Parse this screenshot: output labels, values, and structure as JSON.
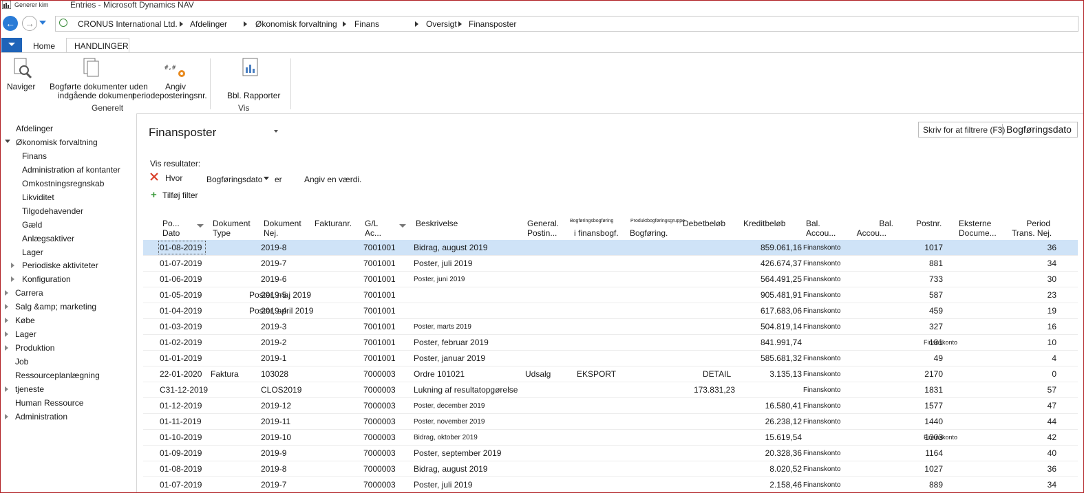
{
  "window": {
    "app_short": "Generer kim",
    "title": "Entries - Microsoft Dynamics NAV"
  },
  "breadcrumb": {
    "items": [
      "CRONUS International Ltd.",
      "Afdelinger",
      "Økonomisk forvaltning",
      "Finans",
      "Oversigt",
      "Finansposter"
    ]
  },
  "ribbon": {
    "tabs": [
      "Home",
      "HANDLINGER"
    ],
    "buttons": {
      "naviger": "Naviger",
      "bogforte_line1": "Bogførte dokumenter uden",
      "bogforte_line2": "indgående dokument",
      "angiv_line1": "Angiv",
      "angiv_line2": "periodeposteringsnr.",
      "rapporter": "Bbl. Rapporter"
    },
    "groups": {
      "generelt": "Generelt",
      "vis": "Vis"
    }
  },
  "sidebar": {
    "items": [
      {
        "label": "Afdelinger"
      },
      {
        "label": "Økonomisk forvaltning"
      },
      {
        "label": "Finans"
      },
      {
        "label": "Administration af kontanter"
      },
      {
        "label": "Omkostningsregnskab"
      },
      {
        "label": "Likviditet"
      },
      {
        "label": "Tilgodehavender"
      },
      {
        "label": "Gæld"
      },
      {
        "label": "Anlægsaktiver"
      },
      {
        "label": "Lager"
      },
      {
        "label": "Periodiske aktiviteter"
      },
      {
        "label": "Konfiguration"
      },
      {
        "label": "Carrera"
      },
      {
        "label": "Salg &amp; marketing"
      },
      {
        "label": "Købe"
      },
      {
        "label": "Lager"
      },
      {
        "label": "Produktion"
      },
      {
        "label": "Job"
      },
      {
        "label": "Ressourceplanlægning"
      },
      {
        "label": "tjeneste"
      },
      {
        "label": "Human Ressource"
      },
      {
        "label": "Administration"
      }
    ]
  },
  "page": {
    "title": "Finansposter",
    "filter_placeholder": "Skriv for at filtrere (F3)",
    "filter_field": "Bogføringsdato",
    "vis_resultater": "Vis resultater:",
    "hvor": "Hvor",
    "filter_name": "Bogføringsdato",
    "er": "er",
    "angiv_vaerdi": "Angiv en værdi.",
    "tilfoj_filter": "Tilføj filter"
  },
  "columns": {
    "po_dato_1": "Po...",
    "po_dato_2": "Dato",
    "dok_type_1": "Dokument",
    "dok_type_2": "Type",
    "dok_nej_1": "Dokument",
    "dok_nej_2": "Nej.",
    "faktura": "Fakturanr.",
    "gl_1": "G/L",
    "gl_2": "Ac...",
    "beskrivelse": "Beskrivelse",
    "general_1": "General.",
    "general_2": "Postin...",
    "bogf_small": "Bogføringsbogføring",
    "bogf_2": "i finansbogf.",
    "prod_small": "Produktbogføringsgruppe",
    "prod_2": "Bogføring.",
    "debet": "Debetbeløb",
    "kredit": "Kreditbeløb",
    "bal1_1": "Bal.",
    "bal1_2": "Accou...",
    "bal2_1": "Bal.",
    "bal2_2": "Accou...",
    "postnr": "Postnr.",
    "ekst_1": "Eksterne",
    "ekst_2": "Docume...",
    "period_1": "Period",
    "period_2": "Trans. Nej."
  },
  "rows": [
    {
      "dato": "01-08-2019",
      "type": "",
      "dok": "2019-8",
      "gl": "7001001",
      "besk": "Bidrag, august 2019",
      "gen": "",
      "bogf": "",
      "prod": "",
      "debet": "",
      "kredit": "859.061,16",
      "bal": "Finanskonto",
      "postnr": "1017",
      "period": "36"
    },
    {
      "dato": "01-07-2019",
      "type": "",
      "dok": "2019-7",
      "gl": "7001001",
      "besk": "Poster, juli 2019",
      "gen": "",
      "bogf": "",
      "prod": "",
      "debet": "",
      "kredit": "426.674,37",
      "bal": "Finanskonto",
      "postnr": "881",
      "period": "34"
    },
    {
      "dato": "01-06-2019",
      "type": "",
      "dok": "2019-6",
      "gl": "7001001",
      "besk": "Poster, juni 2019",
      "gen": "",
      "bogf": "",
      "prod": "",
      "debet": "",
      "kredit": "564.491,25",
      "bal": "Finanskonto",
      "postnr": "733",
      "period": "30"
    },
    {
      "dato": "01-05-2019",
      "type": "Poster, maj 2019",
      "dok": "2019-5",
      "gl": "7001001",
      "besk": "",
      "gen": "",
      "bogf": "",
      "prod": "",
      "debet": "",
      "kredit": "905.481,91",
      "bal": "Finanskonto",
      "postnr": "587",
      "period": "23"
    },
    {
      "dato": "01-04-2019",
      "type": "Poster, april 2019",
      "dok": "2019-4",
      "gl": "7001001",
      "besk": "",
      "gen": "",
      "bogf": "",
      "prod": "",
      "debet": "",
      "kredit": "617.683,06",
      "bal": "Finanskonto",
      "postnr": "459",
      "period": "19"
    },
    {
      "dato": "01-03-2019",
      "type": "",
      "dok": "2019-3",
      "gl": "7001001",
      "besk": "Poster, marts 2019",
      "gen": "",
      "bogf": "",
      "prod": "",
      "debet": "",
      "kredit": "504.819,14",
      "bal": "Finanskonto",
      "postnr": "327",
      "period": "16"
    },
    {
      "dato": "01-02-2019",
      "type": "",
      "dok": "2019-2",
      "gl": "7001001",
      "besk": "Poster, februar 2019",
      "gen": "",
      "bogf": "",
      "prod": "",
      "debet": "",
      "kredit": "841.991,74",
      "bal": "",
      "postnr": "181",
      "period": "10",
      "overlay": "Finanskonto"
    },
    {
      "dato": "01-01-2019",
      "type": "",
      "dok": "2019-1",
      "gl": "7001001",
      "besk": "Poster, januar 2019",
      "gen": "",
      "bogf": "",
      "prod": "",
      "debet": "",
      "kredit": "585.681,32",
      "bal": "Finanskonto",
      "postnr": "49",
      "period": "4"
    },
    {
      "dato": "22-01-2020",
      "type": "Faktura",
      "dok": "103028",
      "gl": "7000003",
      "besk": "Ordre 101021",
      "gen": "Udsalg",
      "bogf": "EKSPORT",
      "prod": "DETAIL",
      "debet": "",
      "kredit": "3.135,13",
      "bal": "Finanskonto",
      "postnr": "2170",
      "period": "0"
    },
    {
      "dato": "C31-12-2019",
      "type": "",
      "dok": "CLOS2019",
      "gl": "7000003",
      "besk": "Lukning af resultatopgørelse",
      "gen": "",
      "bogf": "",
      "prod": "",
      "debet": "173.831,23",
      "kredit": "",
      "bal": "Finanskonto",
      "postnr": "1831",
      "period": "57"
    },
    {
      "dato": "01-12-2019",
      "type": "",
      "dok": "2019-12",
      "gl": "7000003",
      "besk": "Poster, december 2019",
      "gen": "",
      "bogf": "",
      "prod": "",
      "debet": "",
      "kredit": "16.580,41",
      "bal": "Finanskonto",
      "postnr": "1577",
      "period": "47"
    },
    {
      "dato": "01-11-2019",
      "type": "",
      "dok": "2019-11",
      "gl": "7000003",
      "besk": "Poster, november 2019",
      "gen": "",
      "bogf": "",
      "prod": "",
      "debet": "",
      "kredit": "26.238,12",
      "bal": "Finanskonto",
      "postnr": "1440",
      "period": "44"
    },
    {
      "dato": "01-10-2019",
      "type": "",
      "dok": "2019-10",
      "gl": "7000003",
      "besk": "Bidrag, oktober 2019",
      "gen": "",
      "bogf": "",
      "prod": "",
      "debet": "",
      "kredit": "15.619,54",
      "bal": "",
      "postnr": "1303",
      "period": "42",
      "overlay": "Finanskonto"
    },
    {
      "dato": "01-09-2019",
      "type": "",
      "dok": "2019-9",
      "gl": "7000003",
      "besk": "Poster, september 2019",
      "gen": "",
      "bogf": "",
      "prod": "",
      "debet": "",
      "kredit": "20.328,36",
      "bal": "Finanskonto",
      "postnr": "1164",
      "period": "40"
    },
    {
      "dato": "01-08-2019",
      "type": "",
      "dok": "2019-8",
      "gl": "7000003",
      "besk": "Bidrag, august 2019",
      "gen": "",
      "bogf": "",
      "prod": "",
      "debet": "",
      "kredit": "8.020,52",
      "bal": "Finanskonto",
      "postnr": "1027",
      "period": "36"
    },
    {
      "dato": "01-07-2019",
      "type": "",
      "dok": "2019-7",
      "gl": "7000003",
      "besk": "Poster, juli 2019",
      "gen": "",
      "bogf": "",
      "prod": "",
      "debet": "",
      "kredit": "2.158,46",
      "bal": "Finanskonto",
      "postnr": "889",
      "period": "34"
    }
  ],
  "colors": {
    "accent": "#1e63b8",
    "selected_row": "#cfe3f7",
    "window_border": "#b01e23"
  }
}
